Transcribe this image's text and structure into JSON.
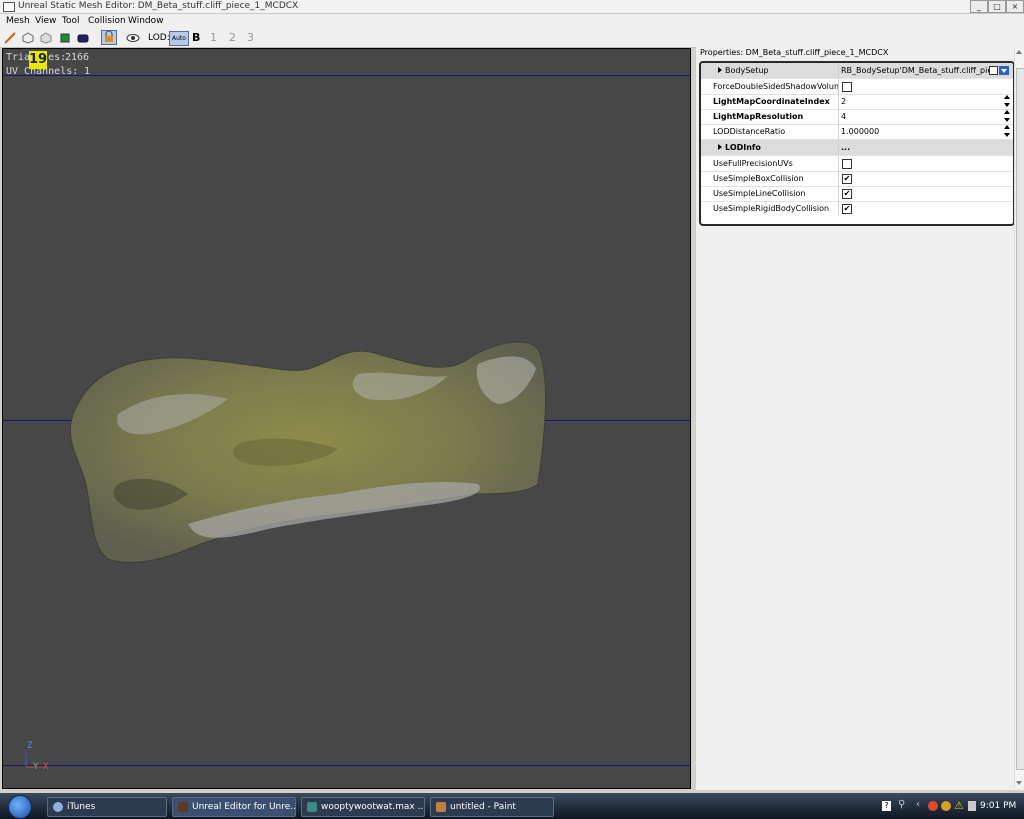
{
  "window": {
    "title": "Unreal Static Mesh Editor: DM_Beta_stuff.cliff_piece_1_MCDCX",
    "minimize_label": "_",
    "maximize_label": "□",
    "close_label": "×"
  },
  "menu": [
    "Mesh",
    "View",
    "Tool",
    "Collision",
    "Window"
  ],
  "toolbar": {
    "lod_label": "LOD:",
    "lod_auto": "Auto",
    "lod_b": "B",
    "lod_1": "1",
    "lod_2": "2",
    "lod_3": "3"
  },
  "viewport": {
    "triangles_label": "Triangles:",
    "triangles_value": "2166",
    "uv_label": "UV Channels:",
    "uv_value": "1",
    "overlay_badge": "19",
    "axis_z": "Z",
    "axis_y": "Y",
    "axis_x": "X"
  },
  "properties": {
    "title": "Properties: DM_Beta_stuff.cliff_piece_1_MCDCX",
    "rows": [
      {
        "name": "BodySetup",
        "value": "RB_BodySetup'DM_Beta_stuff.cliff_pie"
      },
      {
        "name": "ForceDoubleSidedShadowVolume",
        "value": ""
      },
      {
        "name": "LightMapCoordinateIndex",
        "value": "2"
      },
      {
        "name": "LightMapResolution",
        "value": "4"
      },
      {
        "name": "LODDistanceRatio",
        "value": "1.000000"
      },
      {
        "name": "LODInfo",
        "value": "..."
      },
      {
        "name": "UseFullPrecisionUVs",
        "value": ""
      },
      {
        "name": "UseSimpleBoxCollision",
        "value": "✔"
      },
      {
        "name": "UseSimpleLineCollision",
        "value": "✔"
      },
      {
        "name": "UseSimpleRigidBodyCollision",
        "value": "✔"
      }
    ]
  },
  "taskbar": {
    "tasks": [
      "iTunes",
      "Unreal Editor for Unre...",
      "wooptywootwat.max ...",
      "untitled - Paint"
    ],
    "clock": "9:01 PM"
  },
  "colors": {
    "viewport_bg": "#474747",
    "grid_line": "#16167a",
    "rock_moss": "#8a8a3a",
    "rock_stone": "#9a9a96"
  }
}
